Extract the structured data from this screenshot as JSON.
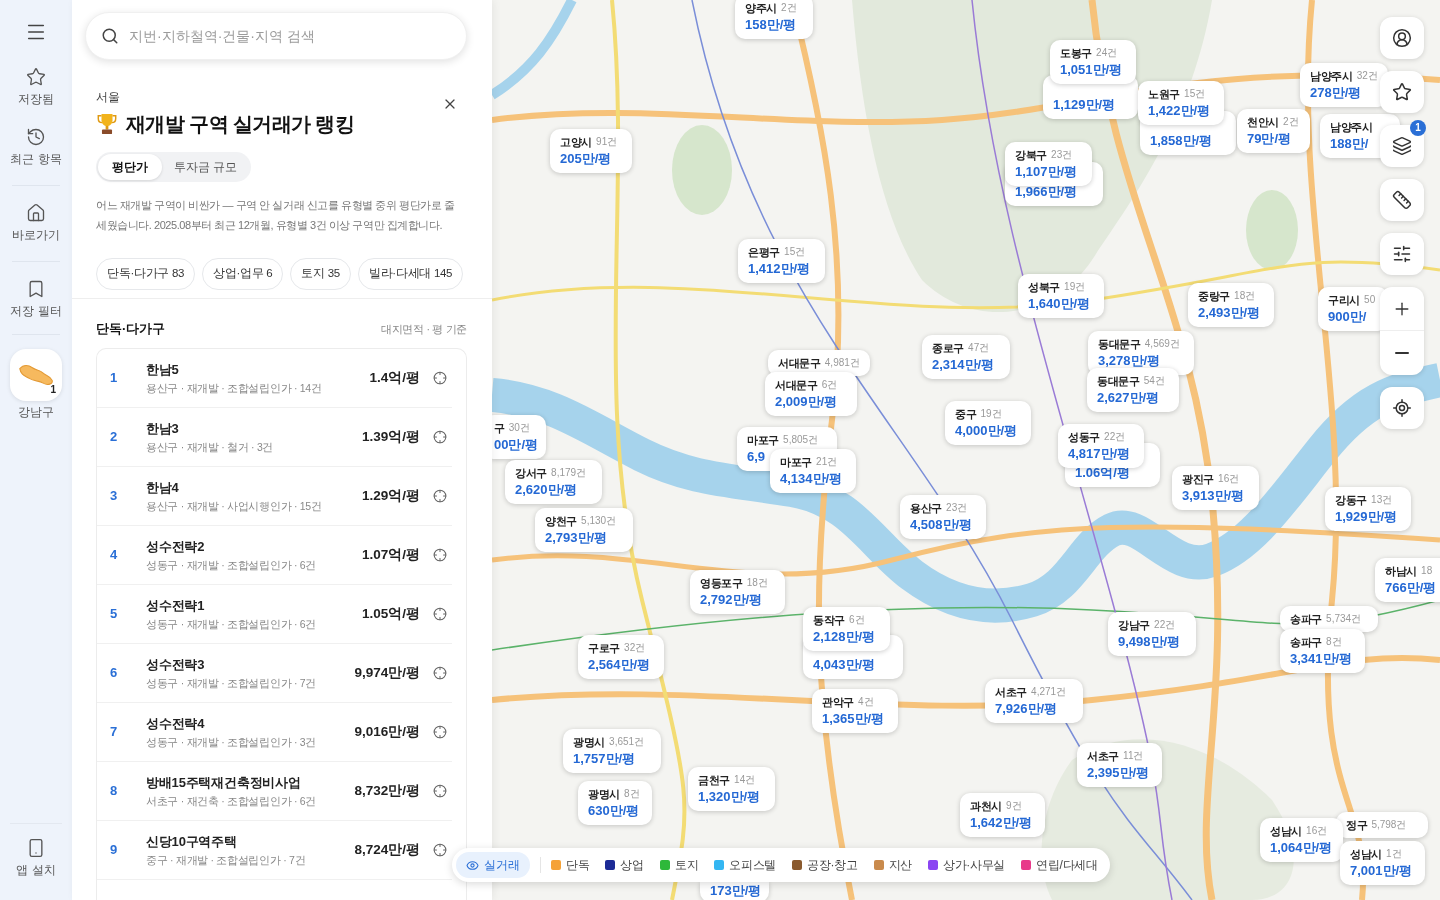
{
  "rail": {
    "items": [
      {
        "kind": "link",
        "label": "저장됨"
      },
      {
        "kind": "link",
        "label": "최근 항목"
      },
      {
        "kind": "link",
        "label": "바로가기"
      },
      {
        "kind": "link",
        "label": "저장 필터"
      },
      {
        "kind": "region",
        "label": "강남구",
        "badge": "1"
      }
    ],
    "bottom": {
      "label": "앱 설치"
    }
  },
  "search": {
    "placeholder": "지번·지하철역·건물·지역 검색"
  },
  "ranking": {
    "region": "서울",
    "title": "재개발 구역 실거래가 랭킹",
    "tabs": [
      {
        "label": "평단가",
        "selected": true
      },
      {
        "label": "투자금 규모",
        "selected": false
      }
    ],
    "description": "어느 재개발 구역이 비싼가 — 구역 안 실거래 신고를 유형별 중위 평단가로 줄 세웠습니다. 2025.08부터 최근 12개월, 유형별 3건 이상 구역만 집계합니다.",
    "categories": [
      "단독·다가구 83",
      "상업·업무 6",
      "토지 35",
      "빌라·다세대 145"
    ],
    "section": {
      "title": "단독·다가구",
      "basis": "대지면적 · 평 기준"
    },
    "rows": [
      {
        "rank": "1",
        "name": "한남5",
        "detail": "용산구 · 재개발 · 조합설립인가 · 14건",
        "price": "1.4억/평"
      },
      {
        "rank": "2",
        "name": "한남3",
        "detail": "용산구 · 재개발 · 철거 · 3건",
        "price": "1.39억/평"
      },
      {
        "rank": "3",
        "name": "한남4",
        "detail": "용산구 · 재개발 · 사업시행인가 · 15건",
        "price": "1.29억/평"
      },
      {
        "rank": "4",
        "name": "성수전략2",
        "detail": "성동구 · 재개발 · 조합설립인가 · 6건",
        "price": "1.07억/평"
      },
      {
        "rank": "5",
        "name": "성수전략1",
        "detail": "성동구 · 재개발 · 조합설립인가 · 6건",
        "price": "1.05억/평"
      },
      {
        "rank": "6",
        "name": "성수전략3",
        "detail": "성동구 · 재개발 · 조합설립인가 · 7건",
        "price": "9,974만/평"
      },
      {
        "rank": "7",
        "name": "성수전략4",
        "detail": "성동구 · 재개발 · 조합설립인가 · 3건",
        "price": "9,016만/평"
      },
      {
        "rank": "8",
        "name": "방배15주택재건축정비사업",
        "detail": "서초구 · 재건축 · 조합설립인가 · 6건",
        "price": "8,732만/평"
      },
      {
        "rank": "9",
        "name": "신당10구역주택",
        "detail": "중구 · 재개발 · 조합설립인가 · 7건",
        "price": "8,724만/평"
      }
    ]
  },
  "map": {
    "layers_badge": "1",
    "markers": [
      {
        "name": "양주시",
        "count": "2건",
        "price": "158만/평"
      },
      {
        "name": "도봉구",
        "count": "24건",
        "price": "1,051만/평"
      },
      {
        "price": "1,129만/평"
      },
      {
        "name": "노원구",
        "count": "15건",
        "price": "1,422만/평"
      },
      {
        "name": "남양주시",
        "count": "32건",
        "price": "278만/평"
      },
      {
        "name": "고양시",
        "count": "91건",
        "price": "205만/평"
      },
      {
        "price": "1,858만/평"
      },
      {
        "name": "천안시",
        "count": "2건",
        "price": "79만/평"
      },
      {
        "name": "남양주시",
        "price": "188만/"
      },
      {
        "name": "강북구",
        "count": "23건",
        "price": "1,107만/평"
      },
      {
        "price": "1,966만/평"
      },
      {
        "name": "은평구",
        "count": "15건",
        "price": "1,412만/평"
      },
      {
        "name": "성북구",
        "count": "19건",
        "price": "1,640만/평"
      },
      {
        "name": "중랑구",
        "count": "18건",
        "price": "2,493만/평"
      },
      {
        "name": "구리시",
        "count": "50",
        "price": "900만/"
      },
      {
        "name": "서대문구",
        "count": "4,981건"
      },
      {
        "name": "종로구",
        "count": "47건",
        "price": "2,314만/평"
      },
      {
        "name": "동대문구",
        "count": "4,569건",
        "price": "3,278만/평"
      },
      {
        "name": "서대문구",
        "count": "6건",
        "price": "2,009만/평"
      },
      {
        "name": "동대문구",
        "count": "54건",
        "price": "2,627만/평"
      },
      {
        "name": "구",
        "count": "30건",
        "price": "00만/평"
      },
      {
        "name": "중구",
        "count": "19건",
        "price": "4,000만/평"
      },
      {
        "name": "마포구",
        "count": "5,805건",
        "price": "6,9"
      },
      {
        "name": "성동구",
        "count": "22건",
        "price": "4,817만/평"
      },
      {
        "name": "강서구",
        "count": "8,179건",
        "price": "2,620만/평"
      },
      {
        "name": "마포구",
        "count": "21건",
        "price": "4,134만/평"
      },
      {
        "price": "1.06억/평"
      },
      {
        "name": "광진구",
        "count": "16건",
        "price": "3,913만/평"
      },
      {
        "name": "양천구",
        "count": "5,130건",
        "price": "2,793만/평"
      },
      {
        "name": "용산구",
        "count": "23건",
        "price": "4,508만/평"
      },
      {
        "name": "강동구",
        "count": "13건",
        "price": "1,929만/평"
      },
      {
        "name": "영등포구",
        "count": "18건",
        "price": "2,792만/평"
      },
      {
        "name": "하남시",
        "count": "18",
        "price": "766만/평"
      },
      {
        "name": "동작구",
        "count": "6건",
        "price": "2,128만/평"
      },
      {
        "name": "강남구",
        "count": "22건",
        "price": "9,498만/평"
      },
      {
        "name": "송파구",
        "count": "5,734건"
      },
      {
        "name": "구로구",
        "count": "32건",
        "price": "2,564만/평"
      },
      {
        "price": "4,043만/평"
      },
      {
        "name": "송파구",
        "count": "8건",
        "price": "3,341만/평"
      },
      {
        "name": "관악구",
        "count": "4건",
        "price": "1,365만/평"
      },
      {
        "name": "서초구",
        "count": "4,271건",
        "price": "7,926만/평"
      },
      {
        "name": "광명시",
        "count": "3,651건",
        "price": "1,757만/평"
      },
      {
        "name": "서초구",
        "count": "11건",
        "price": "2,395만/평"
      },
      {
        "name": "광명시",
        "count": "8건",
        "price": "630만/평"
      },
      {
        "name": "금천구",
        "count": "14건",
        "price": "1,320만/평"
      },
      {
        "name": "과천시",
        "count": "9건",
        "price": "1,642만/평"
      },
      {
        "name": "성남시",
        "count": "16건",
        "price": "1,064만/평"
      },
      {
        "name": "정구",
        "count": "5,798건"
      },
      {
        "name": "성남시",
        "count": "1건",
        "price": "7,001만/평"
      },
      {
        "price": "173만/평"
      }
    ]
  },
  "legend": {
    "toggle": {
      "label": "실거래",
      "selected": true
    },
    "items": [
      {
        "label": "단독",
        "color": "#f5a238"
      },
      {
        "label": "상업",
        "color": "#1c2a96"
      },
      {
        "label": "토지",
        "color": "#2eb83a"
      },
      {
        "label": "오피스텔",
        "color": "#34b6f2"
      },
      {
        "label": "공장·창고",
        "color": "#8a5a2e"
      },
      {
        "label": "지산",
        "color": "#c98a4c"
      },
      {
        "label": "상가·사무실",
        "color": "#8b45f2"
      },
      {
        "label": "연립/다세대",
        "color": "#e8398a"
      }
    ]
  }
}
